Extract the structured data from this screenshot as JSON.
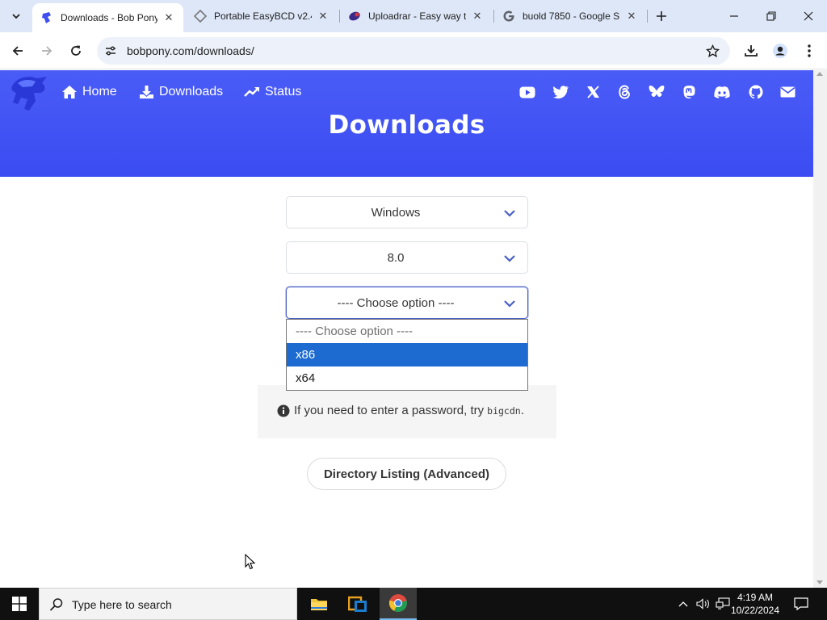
{
  "browser": {
    "tabs": [
      {
        "title": "Downloads - Bob Pony",
        "active": true
      },
      {
        "title": "Portable EasyBCD v2.4",
        "active": false
      },
      {
        "title": "Uploadrar - Easy way t",
        "active": false
      },
      {
        "title": "buold 7850 - Google S",
        "active": false
      }
    ],
    "url": "bobpony.com/downloads/"
  },
  "site": {
    "nav": {
      "home": "Home",
      "downloads": "Downloads",
      "status": "Status"
    },
    "social_icons": [
      "youtube-icon",
      "twitter-icon",
      "x-icon",
      "threads-icon",
      "bluesky-icon",
      "mastodon-icon",
      "discord-icon",
      "github-icon",
      "mail-icon"
    ],
    "colors": {
      "hero": "#3b4cf2",
      "select_focus": "#485fc7",
      "option_selected": "#1d6ad1"
    }
  },
  "main": {
    "title": "Downloads",
    "os_select": "Windows",
    "version_select": "8.0",
    "arch_select": "---- Choose option ----",
    "arch_options": [
      {
        "label": "---- Choose option ----"
      },
      {
        "label": "x86"
      },
      {
        "label": "x64"
      }
    ],
    "notice_text": "If you need to enter a password, try",
    "notice_code": "bigcdn",
    "notice_end": ".",
    "dir_button": "Directory Listing (Advanced)"
  },
  "taskbar": {
    "search_placeholder": "Type here to search",
    "time": "4:19 AM",
    "date": "10/22/2024"
  }
}
